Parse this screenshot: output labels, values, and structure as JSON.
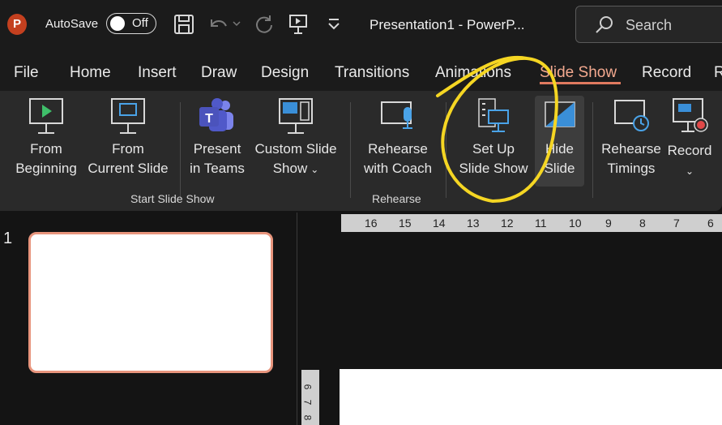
{
  "titlebar": {
    "app_logo": "P",
    "autosave_label": "AutoSave",
    "autosave_state": "Off",
    "document_title": "Presentation1  -  PowerP...",
    "search_placeholder": "Search"
  },
  "tabs": [
    {
      "label": "File"
    },
    {
      "label": "Home"
    },
    {
      "label": "Insert"
    },
    {
      "label": "Draw"
    },
    {
      "label": "Design"
    },
    {
      "label": "Transitions"
    },
    {
      "label": "Animations"
    },
    {
      "label": "Slide Show",
      "active": true
    },
    {
      "label": "Record"
    },
    {
      "label": "R"
    }
  ],
  "ribbon": {
    "start_group": {
      "label": "Start Slide Show",
      "from_beginning": [
        "From",
        "Beginning"
      ],
      "from_current": [
        "From",
        "Current Slide"
      ],
      "present_teams": [
        "Present",
        "in Teams"
      ],
      "custom_show": [
        "Custom Slide",
        "Show"
      ]
    },
    "rehearse_group": {
      "label": "Rehearse",
      "rehearse_coach": [
        "Rehearse",
        "with Coach"
      ]
    },
    "setup": [
      "Set Up",
      "Slide Show"
    ],
    "hide_slide": [
      "Hide",
      "Slide"
    ],
    "rehearse_timings": [
      "Rehearse",
      "Timings"
    ],
    "record": "Record"
  },
  "slides": {
    "number": "1"
  },
  "ruler": {
    "ticks": [
      "16",
      "15",
      "14",
      "13",
      "12",
      "11",
      "10",
      "9",
      "8",
      "7",
      "6"
    ],
    "vertical_ticks": [
      "6",
      "7",
      "8"
    ]
  },
  "colors": {
    "accent": "#e07a5f",
    "annotation": "#f5d623",
    "logo": "#c4401f"
  }
}
